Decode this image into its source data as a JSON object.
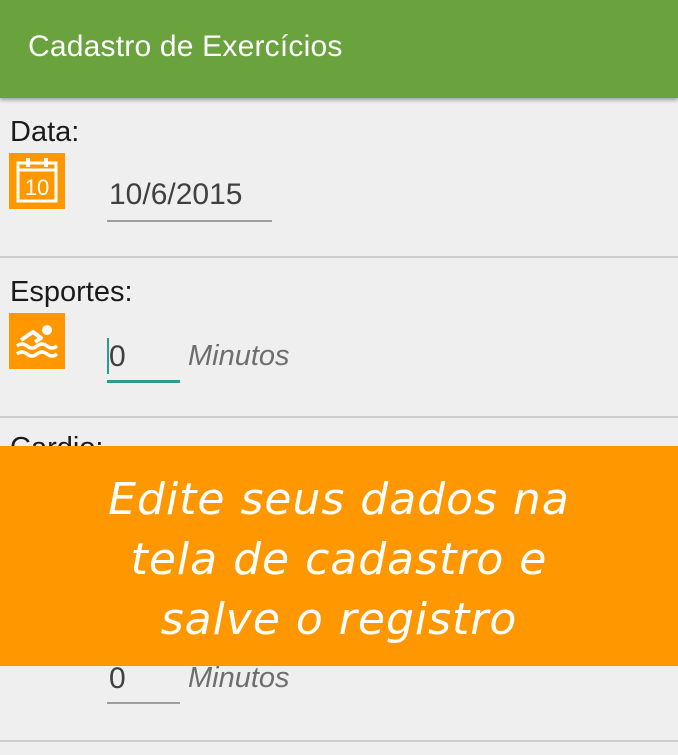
{
  "appbar": {
    "title": "Cadastro de Exercícios"
  },
  "form": {
    "date": {
      "label": "Data:",
      "icon": "calendar-icon",
      "icon_text": "10",
      "value": "10/6/2015"
    },
    "sports": {
      "label": "Esportes:",
      "icon": "swimming-icon",
      "value": "0",
      "unit": "Minutos"
    },
    "cardio": {
      "label": "Cardio:",
      "icon": "cardio-icon",
      "value": "0",
      "unit": "Minutos"
    }
  },
  "banner": {
    "lines": [
      "Edite seus dados na",
      "tela de cadastro e",
      "salve o registro"
    ]
  },
  "colors": {
    "appbar": "#6aa23d",
    "accent": "#ff9800",
    "focus": "#2a9d8f"
  }
}
